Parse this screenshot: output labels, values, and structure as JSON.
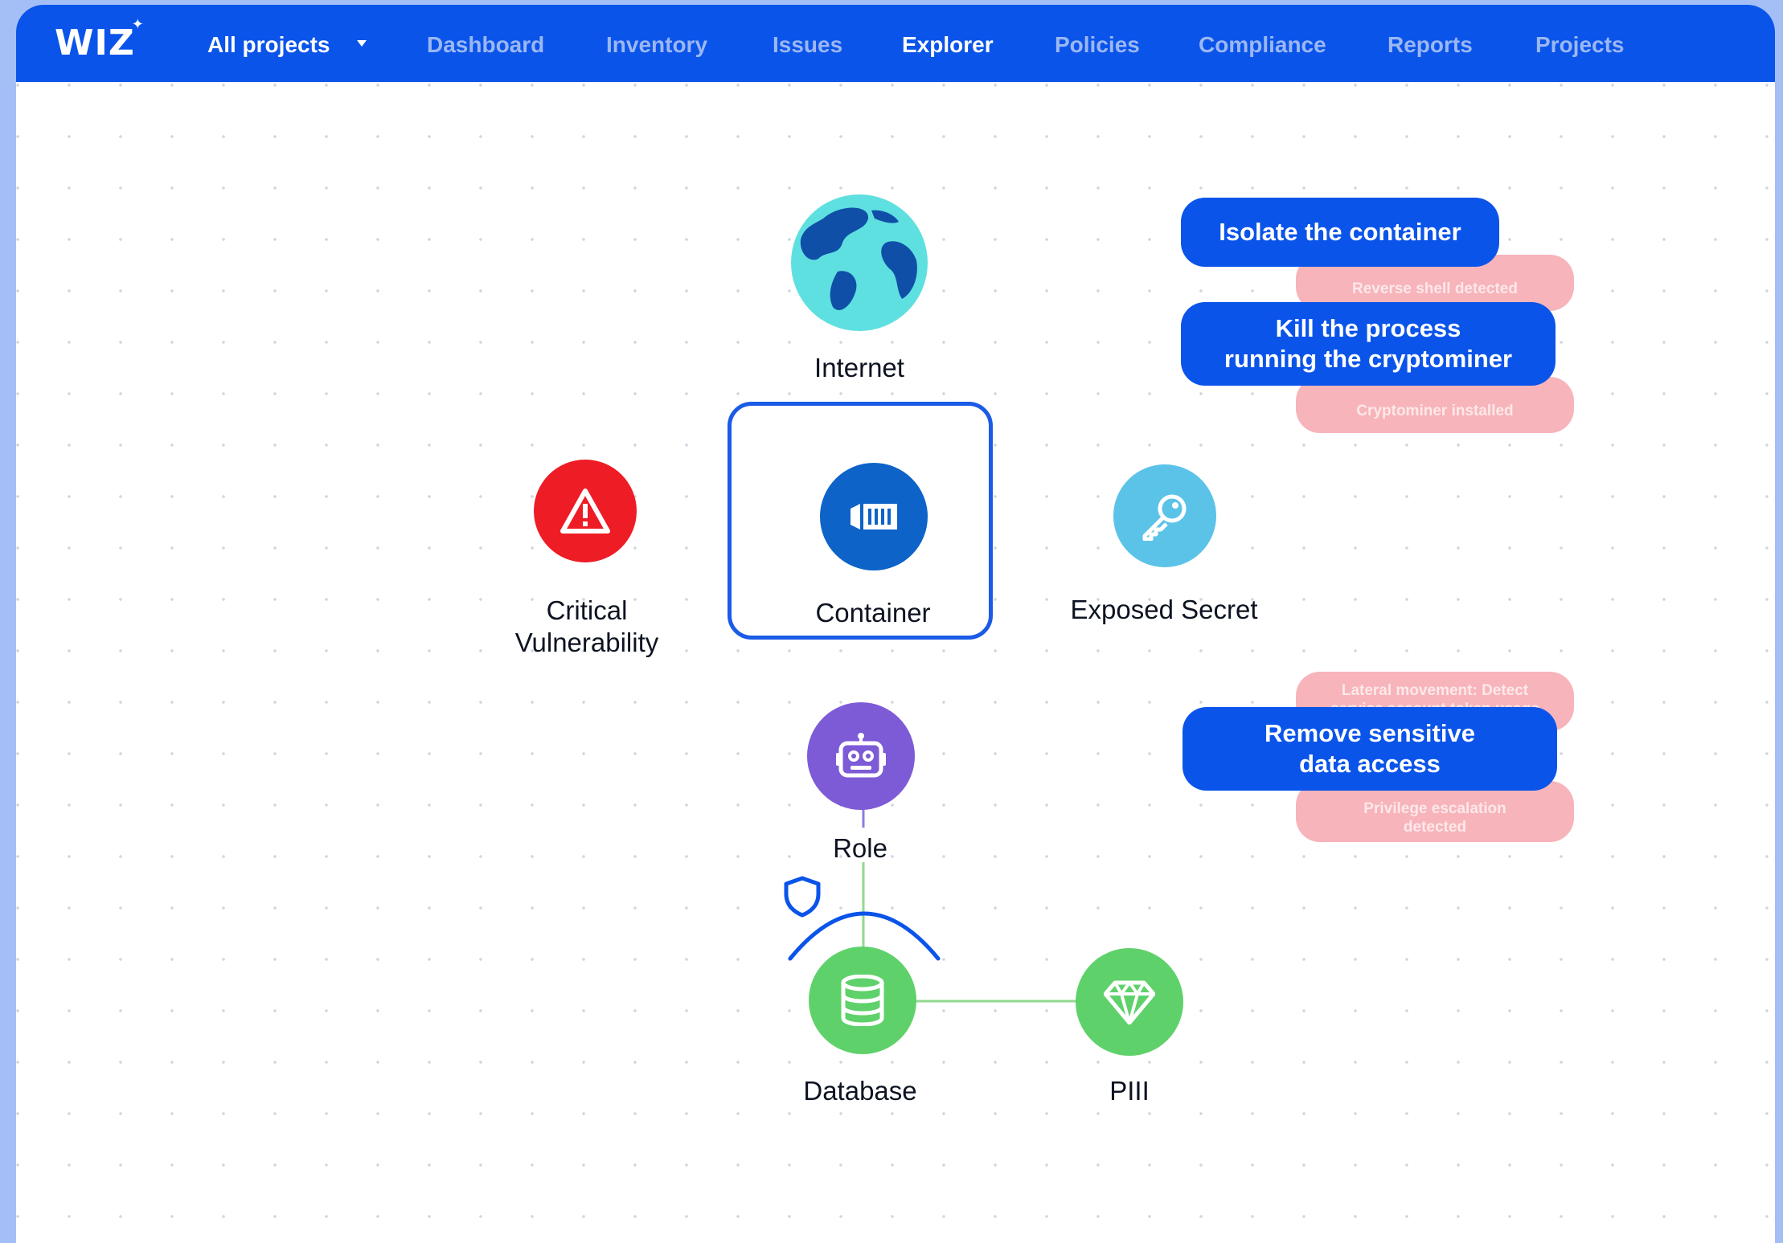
{
  "app": {
    "logo": "WIZ"
  },
  "nav": {
    "project_selector": "All projects",
    "items": [
      "Dashboard",
      "Inventory",
      "Issues",
      "Explorer",
      "Policies",
      "Compliance",
      "Reports",
      "Projects"
    ],
    "active": "Explorer"
  },
  "graph": {
    "nodes": {
      "internet": "Internet",
      "vulnerability": "Critical\nVulnerability",
      "container": "Container",
      "secret": "Exposed Secret",
      "role": "Role",
      "database": "Database",
      "pii": "PIII"
    },
    "actions": {
      "isolate": "Isolate the container",
      "kill": "Kill the process\nrunning the cryptominer",
      "remove": "Remove sensitive\ndata access"
    },
    "alerts": {
      "reverse_shell": "Reverse shell detected",
      "cryptominer": "Cryptominer installed",
      "lateral": "Lateral movement: Detect\nservice account token usage",
      "privilege": "Privilege escalation\ndetected"
    }
  },
  "colors": {
    "brand": "#0a54ea",
    "critical": "#ee1c25",
    "container": "#0d63c8",
    "secret": "#5cc3e8",
    "role": "#7d5bd6",
    "data": "#5fd16a",
    "alert": "#f7b4bb"
  },
  "icons": {
    "internet": "globe-icon",
    "vulnerability": "warning-icon",
    "container": "container-icon",
    "secret": "key-icon",
    "role": "robot-icon",
    "database": "database-icon",
    "pii": "diamond-icon",
    "protection": "shield-icon"
  }
}
